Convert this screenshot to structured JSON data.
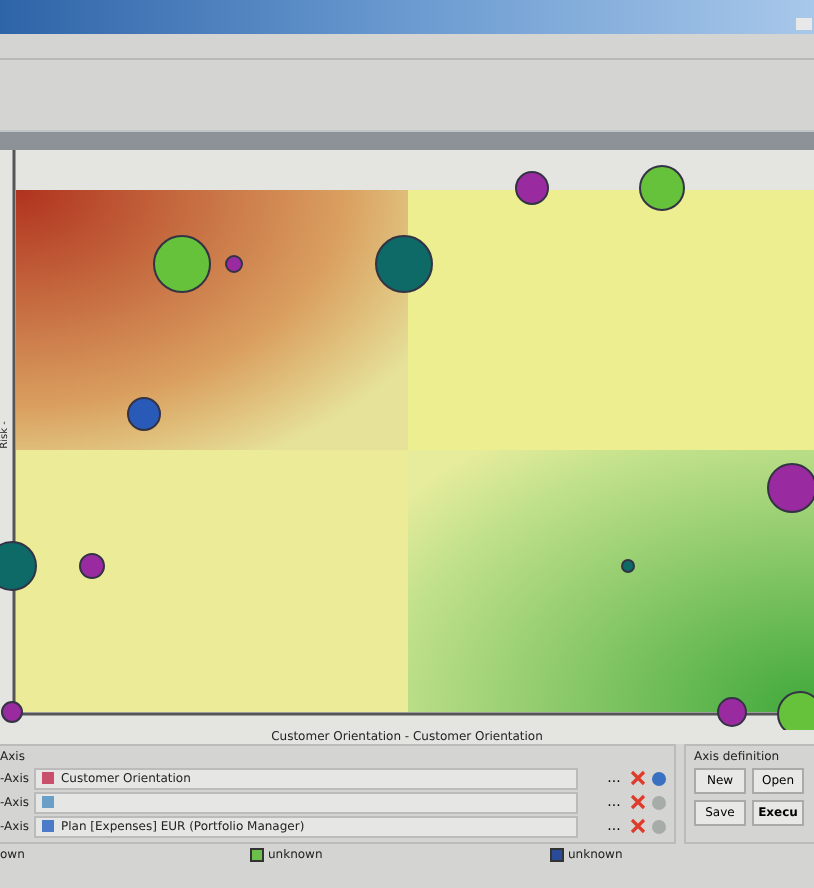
{
  "chart": {
    "y_axis_label": "Risk -",
    "x_axis_label": "Customer Orientation - Customer Orientation"
  },
  "axis_panel": {
    "title": "Axis",
    "rows": [
      {
        "label": "-Axis",
        "value": "Customer Orientation",
        "more": "...",
        "info_enabled": true
      },
      {
        "label": "-Axis",
        "value": "",
        "more": "...",
        "info_enabled": false
      },
      {
        "label": "-Axis",
        "value": "Plan [Expenses] EUR (Portfolio Manager)",
        "more": "...",
        "info_enabled": false
      }
    ]
  },
  "axis_definition": {
    "title": "Axis definition",
    "buttons": [
      "New",
      "Open",
      "Save",
      "Execu"
    ]
  },
  "legend": [
    {
      "label": "own"
    },
    {
      "label": "unknown",
      "color": "#6ac04a"
    },
    {
      "label": "unknown",
      "color": "#2a4a9a"
    }
  ]
}
